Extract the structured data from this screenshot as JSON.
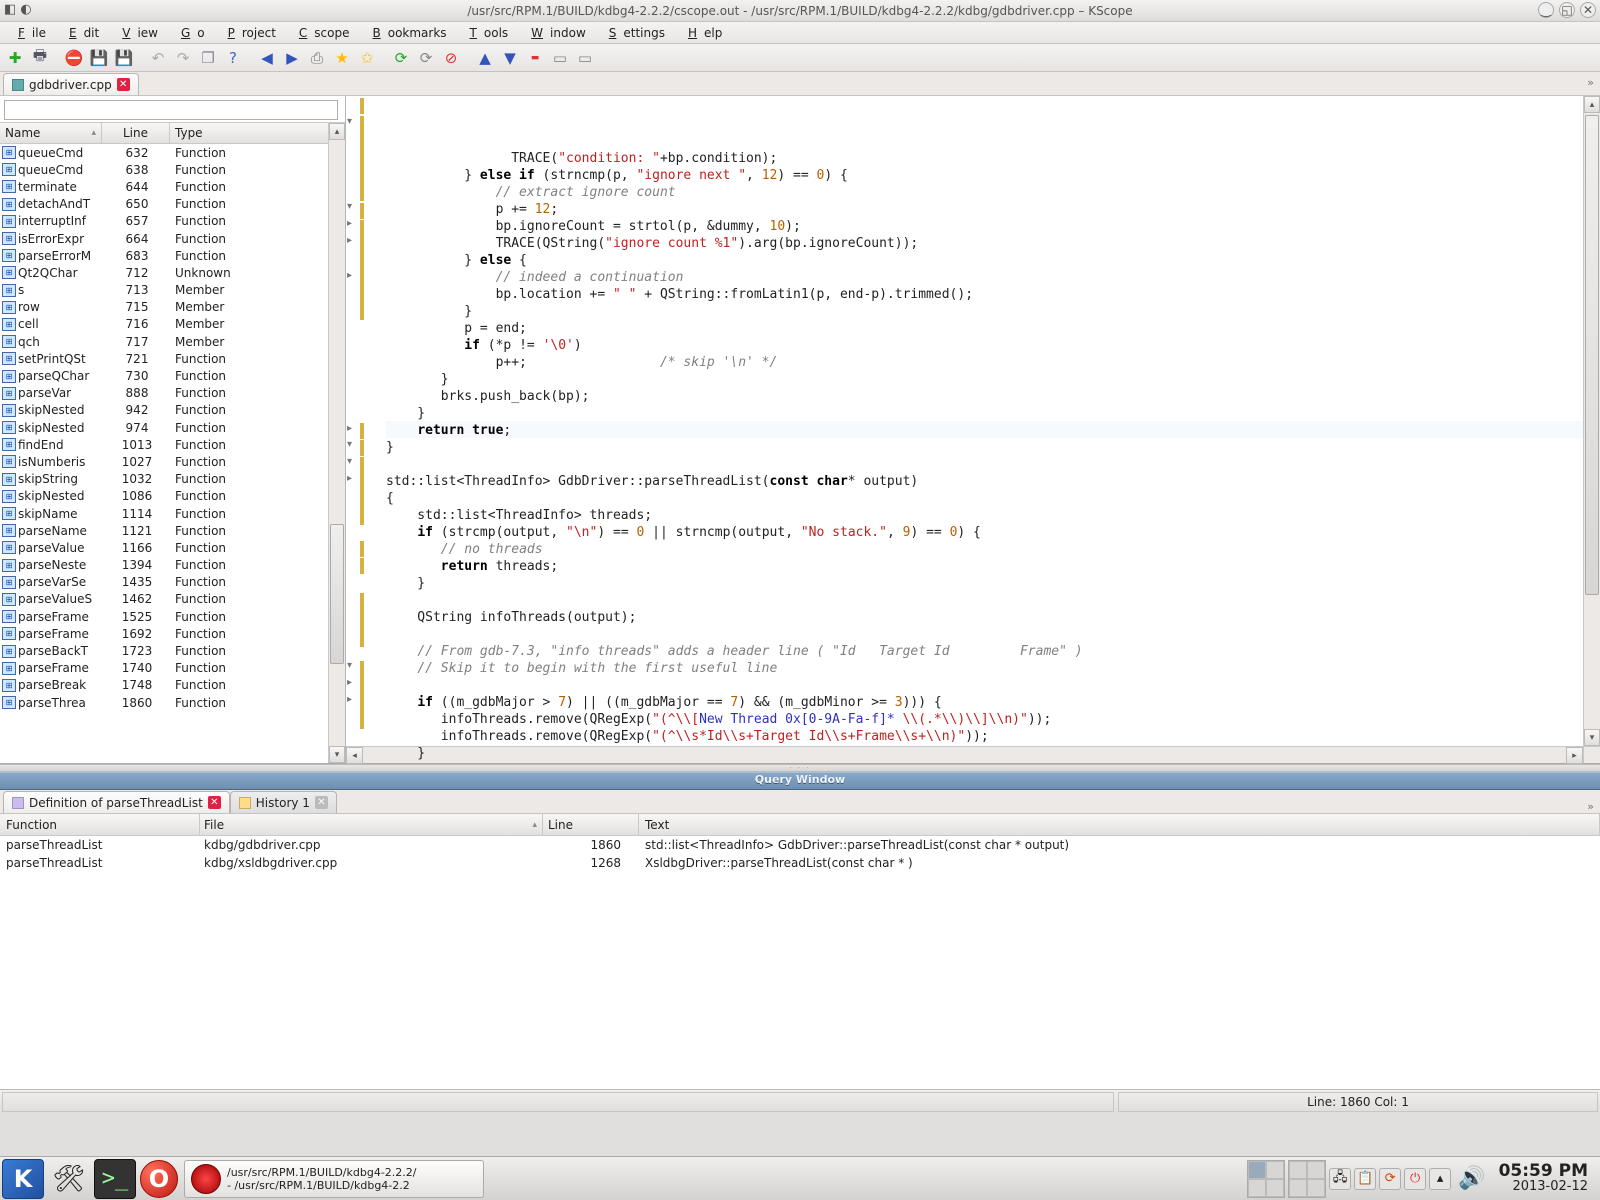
{
  "window": {
    "title": "/usr/src/RPM.1/BUILD/kdbg4-2.2.2/cscope.out - /usr/src/RPM.1/BUILD/kdbg4-2.2.2/kdbg/gdbdriver.cpp – KScope"
  },
  "menus": [
    "File",
    "Edit",
    "View",
    "Go",
    "Project",
    "Cscope",
    "Bookmarks",
    "Tools",
    "Window",
    "Settings",
    "Help"
  ],
  "tab": {
    "label": "gdbdriver.cpp"
  },
  "symtable": {
    "headers": [
      "Name",
      "Line",
      "Type"
    ],
    "rows": [
      {
        "name": "queueCmd",
        "line": "632",
        "type": "Function"
      },
      {
        "name": "queueCmd",
        "line": "638",
        "type": "Function"
      },
      {
        "name": "terminate",
        "line": "644",
        "type": "Function"
      },
      {
        "name": "detachAndT",
        "line": "650",
        "type": "Function"
      },
      {
        "name": "interruptInf",
        "line": "657",
        "type": "Function"
      },
      {
        "name": "isErrorExpr",
        "line": "664",
        "type": "Function"
      },
      {
        "name": "parseErrorM",
        "line": "683",
        "type": "Function"
      },
      {
        "name": "Qt2QChar",
        "line": "712",
        "type": "Unknown"
      },
      {
        "name": "s",
        "line": "713",
        "type": "Member"
      },
      {
        "name": "row",
        "line": "715",
        "type": "Member"
      },
      {
        "name": "cell",
        "line": "716",
        "type": "Member"
      },
      {
        "name": "qch",
        "line": "717",
        "type": "Member"
      },
      {
        "name": "setPrintQSt",
        "line": "721",
        "type": "Function"
      },
      {
        "name": "parseQChar",
        "line": "730",
        "type": "Function"
      },
      {
        "name": "parseVar",
        "line": "888",
        "type": "Function"
      },
      {
        "name": "skipNested",
        "line": "942",
        "type": "Function"
      },
      {
        "name": "skipNested",
        "line": "974",
        "type": "Function"
      },
      {
        "name": "findEnd",
        "line": "1013",
        "type": "Function"
      },
      {
        "name": "isNumberis",
        "line": "1027",
        "type": "Function"
      },
      {
        "name": "skipString",
        "line": "1032",
        "type": "Function"
      },
      {
        "name": "skipNested",
        "line": "1086",
        "type": "Function"
      },
      {
        "name": "skipName",
        "line": "1114",
        "type": "Function"
      },
      {
        "name": "parseName",
        "line": "1121",
        "type": "Function"
      },
      {
        "name": "parseValue",
        "line": "1166",
        "type": "Function"
      },
      {
        "name": "parseNeste",
        "line": "1394",
        "type": "Function"
      },
      {
        "name": "parseVarSe",
        "line": "1435",
        "type": "Function"
      },
      {
        "name": "parseValueS",
        "line": "1462",
        "type": "Function"
      },
      {
        "name": "parseFrame",
        "line": "1525",
        "type": "Function"
      },
      {
        "name": "parseFrame",
        "line": "1692",
        "type": "Function"
      },
      {
        "name": "parseBackT",
        "line": "1723",
        "type": "Function"
      },
      {
        "name": "parseFrame",
        "line": "1740",
        "type": "Function"
      },
      {
        "name": "parseBreak",
        "line": "1748",
        "type": "Function"
      },
      {
        "name": "parseThrea",
        "line": "1860",
        "type": "Function"
      }
    ]
  },
  "query": {
    "title": "Query Window",
    "tabs": [
      {
        "label": "Definition of parseThreadList",
        "closable": true
      },
      {
        "label": "History 1",
        "closable": true
      }
    ],
    "headers": [
      "Function",
      "File",
      "Line",
      "Text"
    ],
    "rows": [
      {
        "func": "parseThreadList",
        "file": "kdbg/gdbdriver.cpp",
        "line": "1860",
        "text": "std::list<ThreadInfo> GdbDriver::parseThreadList(const char * output)"
      },
      {
        "func": "parseThreadList",
        "file": "kdbg/xsldbgdriver.cpp",
        "line": "1268",
        "text": "XsldbgDriver::parseThreadList(const char * )"
      }
    ]
  },
  "status": {
    "pos": "Line: 1860 Col: 1"
  },
  "taskbar": {
    "item_line1": "/usr/src/RPM.1/BUILD/kdbg4-2.2.2/",
    "item_line2": "- /usr/src/RPM.1/BUILD/kdbg4-2.2",
    "time": "05:59 PM",
    "date": "2013-02-12"
  },
  "code_html": "                TRACE(<span class='str'>\"condition: \"</span>+bp.condition);\n          } <span class='kw'>else if</span> (strncmp(p, <span class='str'>\"ignore next \"</span>, <span class='num'>12</span>) == <span class='num'>0</span>) {\n              <span class='cmt'>// extract ignore count</span>\n              p += <span class='num'>12</span>;\n              bp.ignoreCount = strtol(p, &amp;dummy, <span class='num'>10</span>);\n              TRACE(QString(<span class='str'>\"ignore count %1\"</span>).arg(bp.ignoreCount));\n          } <span class='kw'>else</span> {\n              <span class='cmt'>// indeed a continuation</span>\n              bp.location += <span class='str'>\" \"</span> + QString::fromLatin1(p, end-p).trimmed();\n          }\n          p = end;\n          <span class='kw'>if</span> (*p != <span class='str'>'\\0'</span>)\n              p++;                 <span class='cmt'>/* skip '\\n' */</span>\n       }\n       brks.push_back(bp);\n    }\n    <span class='kw'>return</span> <span class='kw'>true</span>;\n}\n\nstd::list&lt;ThreadInfo&gt; GdbDriver::parseThreadList(<span class='kw'>const</span> <span class='kw'>char</span>* output)\n{\n    std::list&lt;ThreadInfo&gt; threads;\n    <span class='kw'>if</span> (strcmp(output, <span class='str'>\"\\n\"</span>) == <span class='num'>0</span> || strncmp(output, <span class='str'>\"No stack.\"</span>, <span class='num'>9</span>) == <span class='num'>0</span>) {\n       <span class='cmt'>// no threads</span>\n       <span class='kw'>return</span> threads;\n    }\n\n    QString infoThreads(output);\n\n    <span class='cmt'>// From gdb-7.3, \"info threads\" adds a header line ( \"Id   Target Id         Frame\" )</span>\n    <span class='cmt'>// Skip it to begin with the first useful line</span>\n\n    <span class='kw'>if</span> ((m_gdbMajor &gt; <span class='num'>7</span>) || ((m_gdbMajor == <span class='num'>7</span>) &amp;&amp; (m_gdbMinor &gt;= <span class='num'>3</span>))) {\n       infoThreads.remove(QRegExp(<span class='str'>\"(^\\\\[</span><span class='rgxb'>New Thread 0x[0-9A-Fa-f]*</span><span class='str'> \\\\(.*\\\\)\\\\]\\\\n)\"</span>));\n       infoThreads.remove(QRegExp(<span class='str'>\"(^\\\\s*Id\\\\s+Target Id\\\\s+Frame\\\\s+\\\\n)\"</span>));\n    }\n\n    QString frameInfo;"
}
